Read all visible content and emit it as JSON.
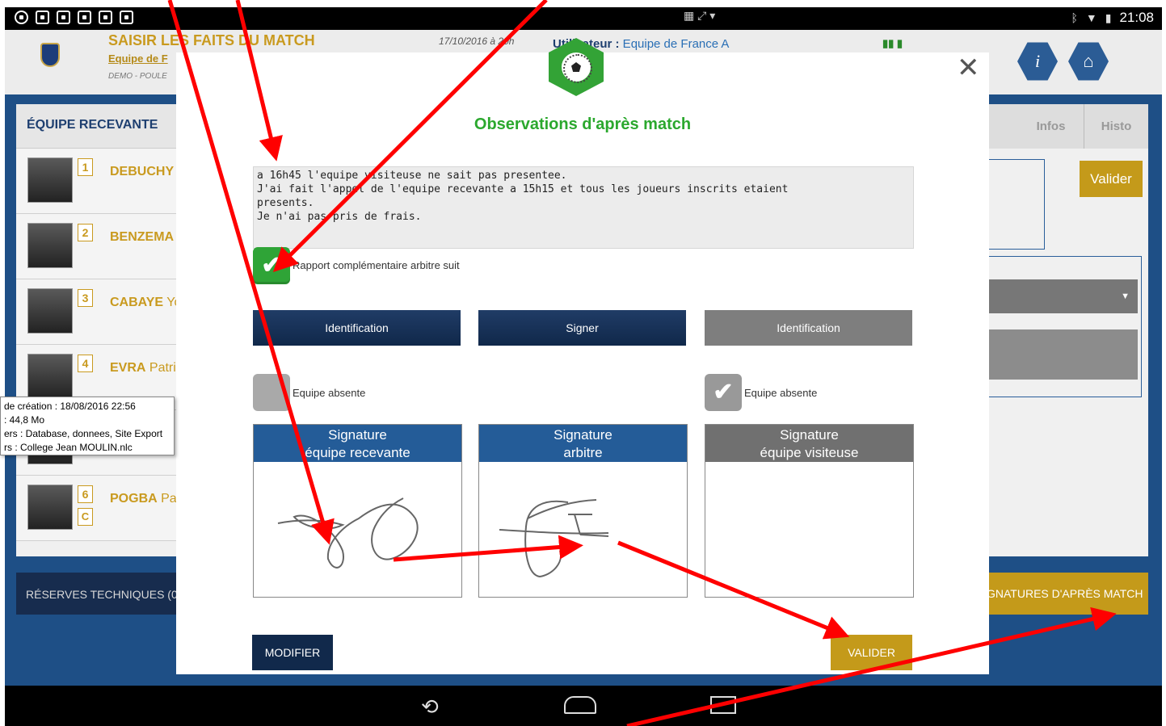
{
  "status_bar": {
    "left_icons": [
      "eye-icon",
      "image-icon",
      "gmail-icon",
      "bag-icon",
      "bag-icon",
      "bag-icon"
    ],
    "time": "21:08"
  },
  "header": {
    "title": "SAISIR LES FAITS DU MATCH",
    "team": "Equipe de F",
    "sub": "DEMO - POULE",
    "date": "17/10/2016 à 20h",
    "user_label": "Utilisateur :",
    "user_value": " Equipe de France A"
  },
  "left_panel": {
    "header": "ÉQUIPE RECEVANTE",
    "players": [
      {
        "num": "1",
        "last": "DEBUCHY",
        "first": " "
      },
      {
        "num": "2",
        "last": "BENZEMA",
        "first": ""
      },
      {
        "num": "3",
        "last": "CABAYE",
        "first": " Yo"
      },
      {
        "num": "4",
        "last": "EVRA",
        "first": " Patri"
      },
      {
        "num": "6",
        "last": "POGBA",
        "first": " Pa",
        "captain": "C"
      }
    ]
  },
  "right_panel": {
    "tabs": [
      "Infos",
      "Histo"
    ],
    "valider": "Valider"
  },
  "bottom": {
    "left": "RÉSERVES TECHNIQUES (0)",
    "right": "GNATURES D'APRÈS MATCH"
  },
  "tooltip": {
    "lines": [
      "de création : 18/08/2016 22:56",
      ": 44,8 Mo",
      "ers : Database, donnees, Site Export",
      "rs : College Jean MOULIN.nlc"
    ]
  },
  "modal": {
    "title": "Observations d'après match",
    "observation_text": "a 16h45 l'equipe visiteuse ne sait pas presentee.\nJ'ai fait l'appel de l'equipe recevante a 15h15 et tous les joueurs inscrits etaient\npresents.\nJe n'ai pas pris de frais.",
    "rapport_label": "Rapport complémentaire arbitre suit",
    "buttons": {
      "identification_left": "Identification",
      "signer": "Signer",
      "identification_right": "Identification"
    },
    "absent_label_left": "Equipe absente",
    "absent_label_right": "Equipe absente",
    "signatures": {
      "home_line1": "Signature",
      "home_line2": "équipe recevante",
      "referee_line1": "Signature",
      "referee_line2": "arbitre",
      "away_line1": "Signature",
      "away_line2": "équipe visiteuse"
    },
    "modifier": "MODIFIER",
    "valider": "VALIDER"
  },
  "colors": {
    "accent_green": "#2ba82e",
    "gold": "#c49a1a",
    "navy": "#11294b",
    "annotation_red": "#ff0000"
  }
}
